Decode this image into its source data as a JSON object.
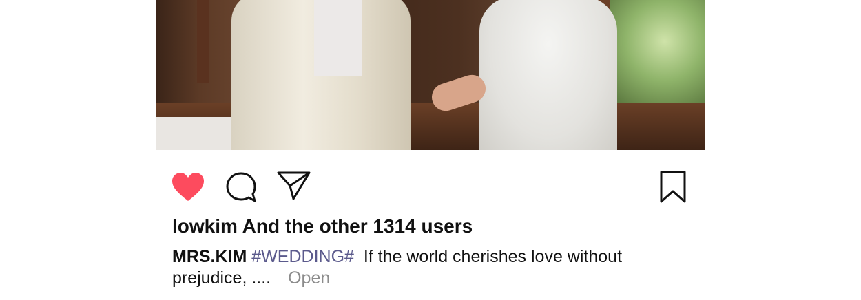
{
  "post": {
    "image_alt": "",
    "liked_by": "lowkim And the other 1314 users",
    "caption": {
      "username": "MRS.KIM",
      "hashtag": "#WEDDING#",
      "text": "If the world cherishes love without prejudice, ....",
      "more_label": "Open"
    }
  },
  "icons": {
    "like": "heart-icon",
    "comment": "comment-icon",
    "share": "send-icon",
    "save": "bookmark-icon"
  },
  "colors": {
    "like_active": "#fd4b5e",
    "hashtag": "#5b5a8c",
    "muted": "#8c8c8c"
  }
}
